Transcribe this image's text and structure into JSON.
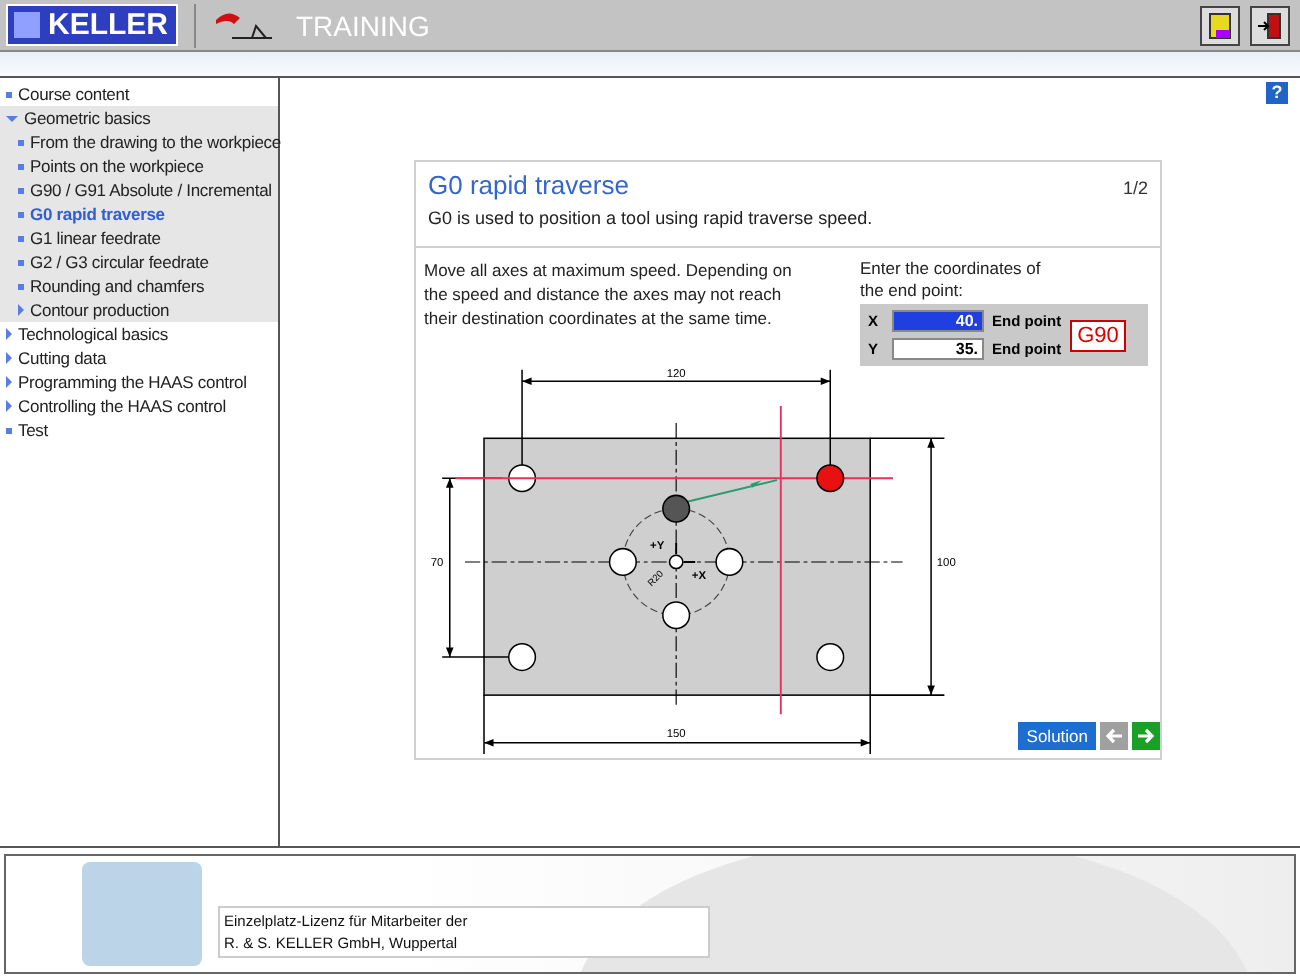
{
  "header": {
    "logo": "KELLER",
    "title": "TRAINING"
  },
  "sidebar": {
    "items": [
      {
        "label": "Course content",
        "kind": "page",
        "selected": false
      },
      {
        "label": "Geometric basics",
        "kind": "folder",
        "expanded": true,
        "selected": false,
        "children": [
          {
            "label": "From the drawing to the workpiece",
            "kind": "page",
            "selected": false
          },
          {
            "label": "Points on the workpiece",
            "kind": "page",
            "selected": false
          },
          {
            "label": "G90 / G91  Absolute / Incremental",
            "kind": "page",
            "selected": false
          },
          {
            "label": "G0 rapid traverse",
            "kind": "page",
            "selected": true
          },
          {
            "label": "G1 linear feedrate",
            "kind": "page",
            "selected": false
          },
          {
            "label": "G2 / G3  circular feedrate",
            "kind": "page",
            "selected": false
          },
          {
            "label": "Rounding and chamfers",
            "kind": "page",
            "selected": false
          },
          {
            "label": "Contour production",
            "kind": "folder",
            "expanded": false,
            "selected": false
          }
        ]
      },
      {
        "label": "Technological basics",
        "kind": "folder",
        "expanded": false,
        "selected": false
      },
      {
        "label": "Cutting data",
        "kind": "folder",
        "expanded": false,
        "selected": false
      },
      {
        "label": "Programming the HAAS control",
        "kind": "folder",
        "expanded": false,
        "selected": false
      },
      {
        "label": "Controlling the HAAS control",
        "kind": "folder",
        "expanded": false,
        "selected": false
      },
      {
        "label": "Test",
        "kind": "page",
        "selected": false
      }
    ]
  },
  "help_button": "?",
  "lesson": {
    "title": "G0 rapid traverse",
    "page": "1/2",
    "intro": "G0 is used to position a tool using rapid traverse speed.",
    "text": "Move all axes at maximum speed. Depending on the speed and distance the axes may not reach their destination coordinates at the same time.",
    "prompt": "Enter the coordinates of the end point:",
    "coordinates": [
      {
        "axis": "X",
        "value": "40.",
        "note": "End point",
        "selected": true
      },
      {
        "axis": "Y",
        "value": "35.",
        "note": "End point",
        "selected": false
      }
    ],
    "mode": "G90",
    "drawing": {
      "dims": [
        "120",
        "70",
        "100",
        "150"
      ],
      "axis_labels": [
        "+Y",
        "+X"
      ],
      "radius": "R20"
    },
    "solution_button": "Solution",
    "back_disabled": true,
    "forward_disabled": false
  },
  "footer": {
    "license": "Einzelplatz-Lizenz für Mitarbeiter der\nR. & S. KELLER GmbH, Wuppertal"
  }
}
